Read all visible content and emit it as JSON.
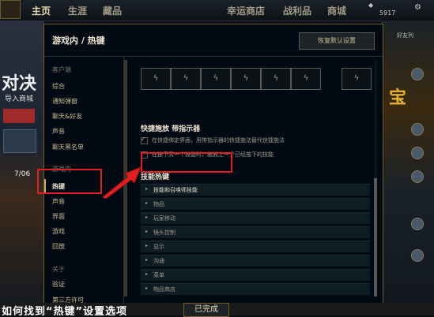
{
  "topbar": {
    "home": "主页",
    "life": "生涯",
    "collection": "藏品",
    "lucky_shop": "幸运商店",
    "loot": "战利品",
    "store": "商城",
    "currency_value": "5917"
  },
  "background": {
    "left_big_text": "对决",
    "left_small_text": "导入商城",
    "left_date": "7/06",
    "right_friends_label": "好友列",
    "right_big_text": "宝"
  },
  "modal": {
    "title": "游戏内 / 热键",
    "reset_label": "恢复默认设置",
    "sidebar": {
      "group_client": "客户端",
      "client_items": [
        "综合",
        "通知弹窗",
        "聊天&好友",
        "声音",
        "聊天黑名单"
      ],
      "group_ingame": "游戏内",
      "ingame_items": [
        "热键",
        "声音",
        "界面",
        "游戏",
        "回放"
      ],
      "group_about": "关于",
      "about_items": [
        "验证",
        "第三方许可"
      ]
    },
    "quick_cast": {
      "title": "快捷施放 带指示器",
      "option1": "在快捷绑定界面，用带指示器的快捷施法替代快捷施法",
      "option2": "在按下另一个技能时，施放上一个已经按下的技能",
      "option1_checked": true,
      "option2_checked": false
    },
    "skill_hotkeys": {
      "title": "技能热键",
      "rows": [
        "技能和召唤师技能",
        "物品",
        "玩家移动",
        "镜头控制",
        "显示",
        "沟通",
        "菜单",
        "物品商店"
      ]
    }
  },
  "footer": {
    "caption": "如何找到“热键”设置选项",
    "done_label": "已完成"
  },
  "colors": {
    "gold": "#c8aa6e",
    "annotation_red": "#e02020",
    "modal_bg": "#010a13"
  }
}
